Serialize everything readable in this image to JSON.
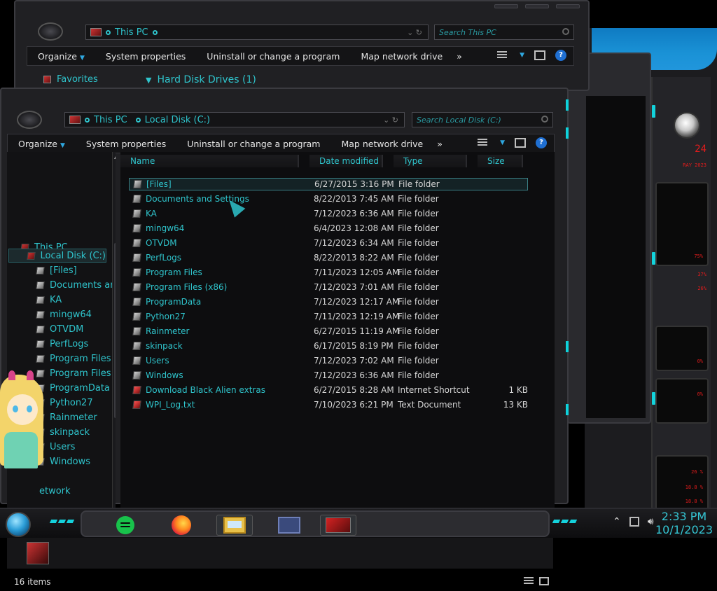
{
  "back_window": {
    "address": {
      "location": "This PC"
    },
    "search": {
      "placeholder": "Search This PC"
    },
    "toolbar": {
      "organize": "Organize",
      "system_properties": "System properties",
      "uninstall": "Uninstall or change a program",
      "map_drive": "Map network drive",
      "more": "»"
    },
    "nav": {
      "favorites": "Favorites"
    },
    "section": "Hard Disk Drives (1)"
  },
  "front_window": {
    "address": {
      "root": "This PC",
      "current": "Local Disk (C:)"
    },
    "search": {
      "placeholder": "Search Local Disk (C:)"
    },
    "toolbar": {
      "organize": "Organize",
      "system_properties": "System properties",
      "uninstall": "Uninstall or change a program",
      "map_drive": "Map network drive",
      "more": "»"
    },
    "nav_items": [
      {
        "label": "This PC"
      },
      {
        "label": "Local Disk (C:)"
      },
      {
        "label": "[Files]"
      },
      {
        "label": "Documents ar"
      },
      {
        "label": "KA"
      },
      {
        "label": "mingw64"
      },
      {
        "label": "OTVDM"
      },
      {
        "label": "PerfLogs"
      },
      {
        "label": "Program Files"
      },
      {
        "label": "Program Files"
      },
      {
        "label": "ProgramData"
      },
      {
        "label": "Python27"
      },
      {
        "label": "Rainmeter"
      },
      {
        "label": "skinpack"
      },
      {
        "label": "Users"
      },
      {
        "label": "Windows"
      },
      {
        "label": "etwork"
      }
    ],
    "columns": {
      "name": "Name",
      "date": "Date modified",
      "type": "Type",
      "size": "Size"
    },
    "files": [
      {
        "name": "[Files]",
        "date": "6/27/2015 3:16 PM",
        "type": "File folder",
        "size": ""
      },
      {
        "name": "Documents and Settings",
        "date": "8/22/2013 7:45 AM",
        "type": "File folder",
        "size": ""
      },
      {
        "name": "KA",
        "date": "7/12/2023 6:36 AM",
        "type": "File folder",
        "size": ""
      },
      {
        "name": "mingw64",
        "date": "6/4/2023 12:08 AM",
        "type": "File folder",
        "size": ""
      },
      {
        "name": "OTVDM",
        "date": "7/12/2023 6:34 AM",
        "type": "File folder",
        "size": ""
      },
      {
        "name": "PerfLogs",
        "date": "8/22/2013 8:22 AM",
        "type": "File folder",
        "size": ""
      },
      {
        "name": "Program Files",
        "date": "7/11/2023 12:05 AM",
        "type": "File folder",
        "size": ""
      },
      {
        "name": "Program Files (x86)",
        "date": "7/12/2023 7:01 AM",
        "type": "File folder",
        "size": ""
      },
      {
        "name": "ProgramData",
        "date": "7/12/2023 12:17 AM",
        "type": "File folder",
        "size": ""
      },
      {
        "name": "Python27",
        "date": "7/11/2023 12:19 AM",
        "type": "File folder",
        "size": ""
      },
      {
        "name": "Rainmeter",
        "date": "6/27/2015 11:19 AM",
        "type": "File folder",
        "size": ""
      },
      {
        "name": "skinpack",
        "date": "6/17/2015 8:19 PM",
        "type": "File folder",
        "size": ""
      },
      {
        "name": "Users",
        "date": "7/12/2023 7:02 AM",
        "type": "File folder",
        "size": ""
      },
      {
        "name": "Windows",
        "date": "7/12/2023 6:36 AM",
        "type": "File folder",
        "size": ""
      },
      {
        "name": "Download Black Alien extras",
        "date": "6/27/2015 8:28 AM",
        "type": "Internet Shortcut",
        "size": "1 KB"
      },
      {
        "name": "WPI_Log.txt",
        "date": "7/10/2023 6:21 PM",
        "type": "Text Document",
        "size": "13 KB"
      }
    ],
    "status": {
      "count": "16 items"
    }
  },
  "taskbar": {
    "apps": [
      "spotify-icon",
      "firefox-icon",
      "file-explorer-icon",
      "screen-app-icon",
      "alien-app-icon"
    ],
    "time": "2:33 PM",
    "date": "10/1/2023"
  },
  "widget": {
    "readouts": [
      "24",
      "RAY 2023",
      "75%",
      "37%",
      "26%",
      "0%",
      "0%",
      "26 %",
      "18.8 %",
      "18.8 %"
    ]
  },
  "colors": {
    "accent": "#2fc4cc",
    "window_bg": "#202023",
    "content_bg": "#0d0d0f",
    "led": "#0ed2db",
    "alert_red": "#e21c1c"
  }
}
